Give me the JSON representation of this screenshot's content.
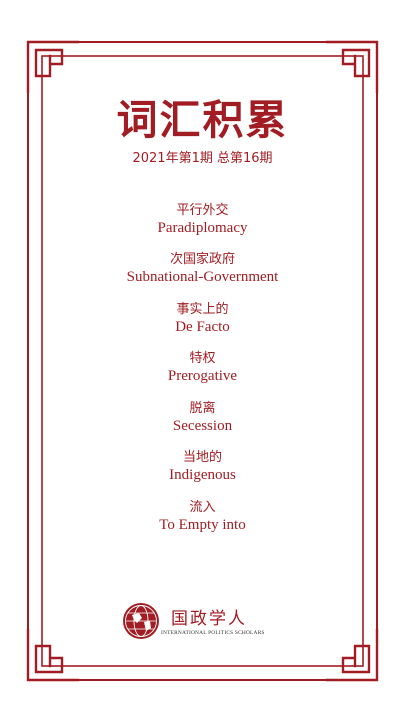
{
  "colors": {
    "accent": "#a11d23",
    "background": "#ffffff"
  },
  "title": "词汇积累",
  "issue": "2021年第1期 总第16期",
  "terms": [
    {
      "zh": "平行外交",
      "en": "Paradiplomacy"
    },
    {
      "zh": "次国家政府",
      "en": "Subnational-Government"
    },
    {
      "zh": "事实上的",
      "en": "De Facto"
    },
    {
      "zh": "特权",
      "en": "Prerogative"
    },
    {
      "zh": "脱离",
      "en": "Secession"
    },
    {
      "zh": "当地的",
      "en": "Indigenous"
    },
    {
      "zh": "流入",
      "en": "To Empty into"
    }
  ],
  "logo": {
    "name_cn": "国政学人",
    "name_en": "INTERNATIONAL POLITICS SCHOLARS"
  }
}
